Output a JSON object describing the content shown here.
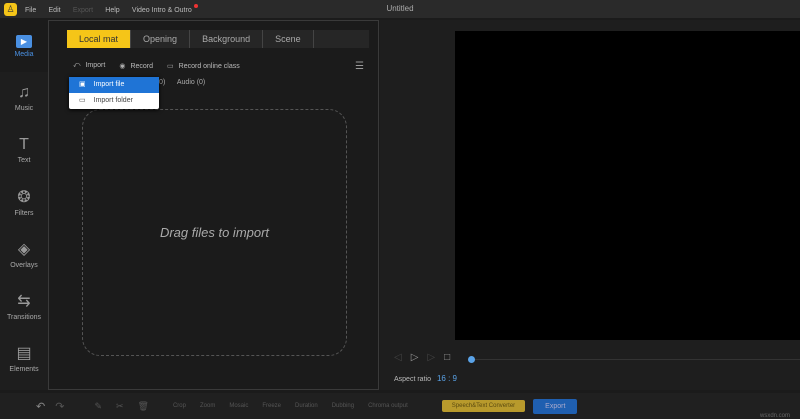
{
  "titlebar": {
    "title": "Untitled",
    "menu": [
      "File",
      "Edit",
      "Export",
      "Help",
      "Video Intro & Outro"
    ]
  },
  "sidebar": [
    {
      "label": "Media",
      "icon": "play-icon"
    },
    {
      "label": "Music",
      "icon": "music-icon"
    },
    {
      "label": "Text",
      "icon": "text-icon"
    },
    {
      "label": "Filters",
      "icon": "filters-icon"
    },
    {
      "label": "Overlays",
      "icon": "overlays-icon"
    },
    {
      "label": "Transitions",
      "icon": "transitions-icon"
    },
    {
      "label": "Elements",
      "icon": "elements-icon"
    }
  ],
  "tabs": [
    "Local mat",
    "Opening",
    "Background",
    "Scene"
  ],
  "tools": {
    "import": "Import",
    "record": "Record",
    "record_online": "Record online class"
  },
  "filters": [
    "ge (0)",
    "Audio (0)"
  ],
  "dropdown": {
    "import_file": "Import file",
    "import_folder": "Import folder"
  },
  "drop_text": "Drag files to import",
  "preview": {
    "aspect_label": "Aspect ratio",
    "aspect_value": "16 : 9",
    "progress": 0
  },
  "bottom": {
    "tools": [
      "Crop",
      "Zoom",
      "Mosaic",
      "Freeze",
      "Duration",
      "Dubbing",
      "Chroma output"
    ],
    "speech": "Speech&Text Converter",
    "export": "Export",
    "watermark": "wsxdn.com"
  },
  "colors": {
    "accent": "#f5c518",
    "blue": "#1f74d6"
  }
}
